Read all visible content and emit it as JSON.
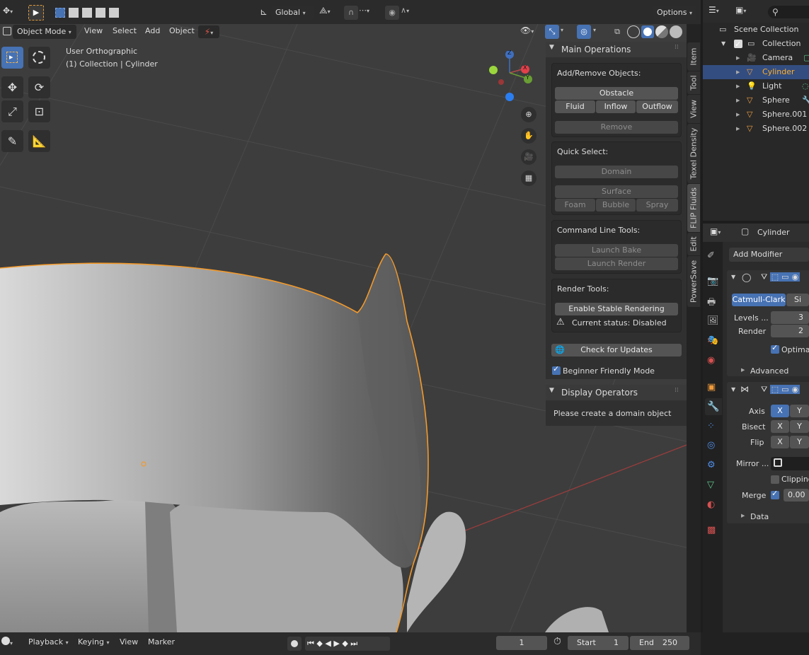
{
  "top_header": {
    "orientation": "Global",
    "options_label": "Options"
  },
  "viewport_header": {
    "mode": "Object Mode",
    "menus": [
      "View",
      "Select",
      "Add",
      "Object"
    ]
  },
  "viewport_overlay": {
    "view_name": "User Orthographic",
    "collection_info": "(1) Collection | Cylinder"
  },
  "gizmo": {
    "x": "X",
    "y": "Y",
    "z": "Z"
  },
  "sidebar_tabs": [
    "Item",
    "Tool",
    "View",
    "Texel Density",
    "FLIP Fluids",
    "Edit",
    "PowerSave"
  ],
  "flip_panel": {
    "main_title": "Main Operations",
    "add_remove_label": "Add/Remove Objects:",
    "obstacle": "Obstacle",
    "fluid": "Fluid",
    "inflow": "Inflow",
    "outflow": "Outflow",
    "remove": "Remove",
    "quick_select_label": "Quick Select:",
    "domain": "Domain",
    "surface": "Surface",
    "foam": "Foam",
    "bubble": "Bubble",
    "spray": "Spray",
    "cmd_label": "Command Line Tools:",
    "launch_bake": "Launch Bake",
    "launch_render": "Launch Render",
    "render_tools_label": "Render Tools:",
    "enable_stable": "Enable Stable Rendering",
    "current_status": "Current status: Disabled",
    "check_updates": "Check for Updates",
    "beginner_mode": "Beginner Friendly Mode",
    "display_title": "Display Operators",
    "domain_msg": "Please create a domain object"
  },
  "outliner": {
    "root": "Scene Collection",
    "collection": "Collection",
    "items": [
      "Camera",
      "Cylinder",
      "Light",
      "Sphere",
      "Sphere.001",
      "Sphere.002"
    ]
  },
  "properties": {
    "object_name": "Cylinder",
    "add_modifier": "Add Modifier",
    "subsurf_type": "Catmull-Clark",
    "subsurf_simple": "Si",
    "levels_label": "Levels ...",
    "levels_value": "3",
    "render_label": "Render",
    "render_value": "2",
    "optimal_label": "Optimal",
    "advanced_label": "Advanced",
    "axis_label": "Axis",
    "bisect_label": "Bisect",
    "flip_label": "Flip",
    "x": "X",
    "y": "Y",
    "mirror_obj_label": "Mirror ...",
    "clipping_label": "Clipping",
    "merge_label": "Merge",
    "merge_value": "0.00",
    "data_label": "Data"
  },
  "timeline": {
    "playback": "Playback",
    "keying": "Keying",
    "view": "View",
    "marker": "Marker",
    "current_frame": "1",
    "start_label": "Start",
    "start_value": "1",
    "end_label": "End",
    "end_value": "250"
  },
  "colors": {
    "accent": "#4772b3",
    "selection_outline": "#f39a2b",
    "viewport_bg": "#3d3d3d"
  }
}
